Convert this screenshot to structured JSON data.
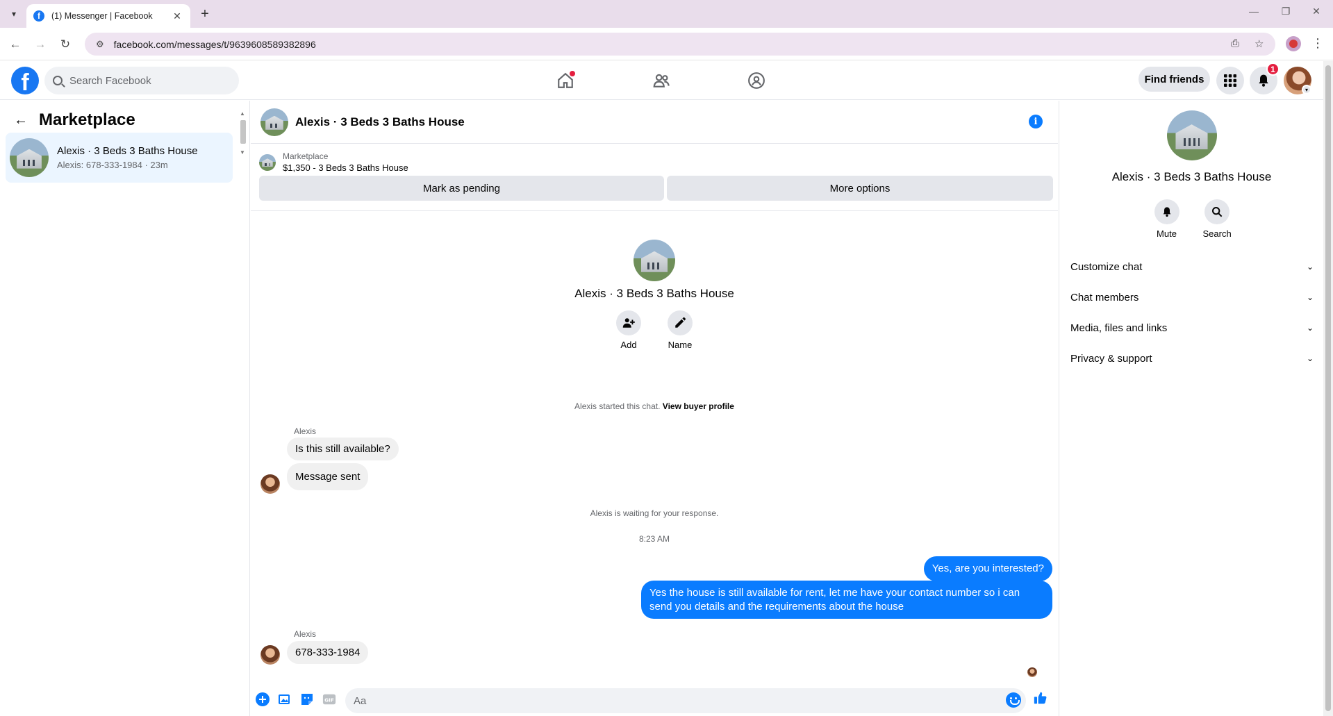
{
  "browser": {
    "tab_title": "(1) Messenger | Facebook",
    "url": "facebook.com/messages/t/9639608589382896",
    "accent": "#e9ddeb"
  },
  "header": {
    "search_placeholder": "Search Facebook",
    "find_friends": "Find friends",
    "notification_count": "1",
    "brand_color": "#1877f2"
  },
  "left": {
    "title": "Marketplace",
    "conversation": {
      "name": "Alexis · 3 Beds 3 Baths House",
      "preview": "Alexis: 678-333-1984 · 23m"
    }
  },
  "chat": {
    "title": "Alexis · 3 Beds 3 Baths House",
    "marketplace_label": "Marketplace",
    "listing": "$1,350 - 3 Beds 3 Baths House",
    "mark_pending": "Mark as pending",
    "more_options": "More options",
    "intro_name": "Alexis · 3 Beds 3 Baths House",
    "add_label": "Add",
    "name_label": "Name",
    "started_text": "Alexis started this chat.",
    "view_buyer_profile": "View buyer profile",
    "messages": [
      {
        "sender": "Alexis",
        "text": "Is this still available?"
      },
      {
        "text": "Message sent"
      },
      {
        "system": "Alexis is waiting for your response."
      },
      {
        "time": "8:23 AM"
      },
      {
        "out": "Yes, are you interested?"
      },
      {
        "out": "Yes the house is still available for rent, let me have your contact number so i can send you details and the requirements about the house"
      },
      {
        "sender": "Alexis",
        "text": "678-333-1984"
      }
    ],
    "composer_placeholder": "Aa",
    "outgoing_color": "#0a7cff"
  },
  "right": {
    "name": "Alexis · 3 Beds 3 Baths House",
    "mute": "Mute",
    "search": "Search",
    "sections": [
      "Customize chat",
      "Chat members",
      "Media, files and links",
      "Privacy & support"
    ]
  }
}
